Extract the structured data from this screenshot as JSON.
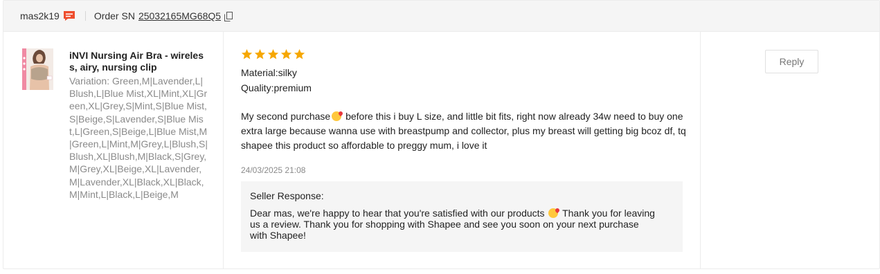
{
  "header": {
    "username": "mas2k19",
    "order_label": "Order SN",
    "order_sn": "25032165MG68Q5"
  },
  "product": {
    "name": "iNVI Nursing Air Bra - wireless, airy, nursing clip",
    "variation": "Variation: Green,M|Lavender,L|Blush,L|Blue Mist,XL|Mint,XL|Green,XL|Grey,S|Mint,S|Blue Mist,S|Beige,S|Lavender,S|Blue Mist,L|Green,S|Beige,L|Blue Mist,M|Green,L|Mint,M|Grey,L|Blush,S|Blush,XL|Blush,M|Black,S|Grey,M|Grey,XL|Beige,XL|Lavender,M|Lavender,XL|Black,XL|Black,M|Mint,L|Black,L|Beige,M"
  },
  "review": {
    "rating": 5,
    "material": "Material:silky",
    "quality": "Quality:premium",
    "comment_before_emoji": "My second purchase",
    "comment_after_emoji": " before this i buy L size, and little bit fits, right now already 34w need to buy one extra large because wanna use with breastpump and collector, plus my breast will getting big bcoz df, tq shapee this product so affordable to preggy mum, i love it",
    "date": "24/03/2025 21:08"
  },
  "seller_response": {
    "title": "Seller Response:",
    "body_before_emoji": "Dear mas, we're happy to hear that you're satisfied with our products ",
    "body_after_emoji": " Thank you for leaving us a review. Thank you for shopping with Shapee and see you soon on your next purchase with Shapee!"
  },
  "actions": {
    "reply_label": "Reply"
  },
  "colors": {
    "star": "#f6a700",
    "chat_icon": "#ee4d2d",
    "panel_bg": "#f5f5f5"
  }
}
